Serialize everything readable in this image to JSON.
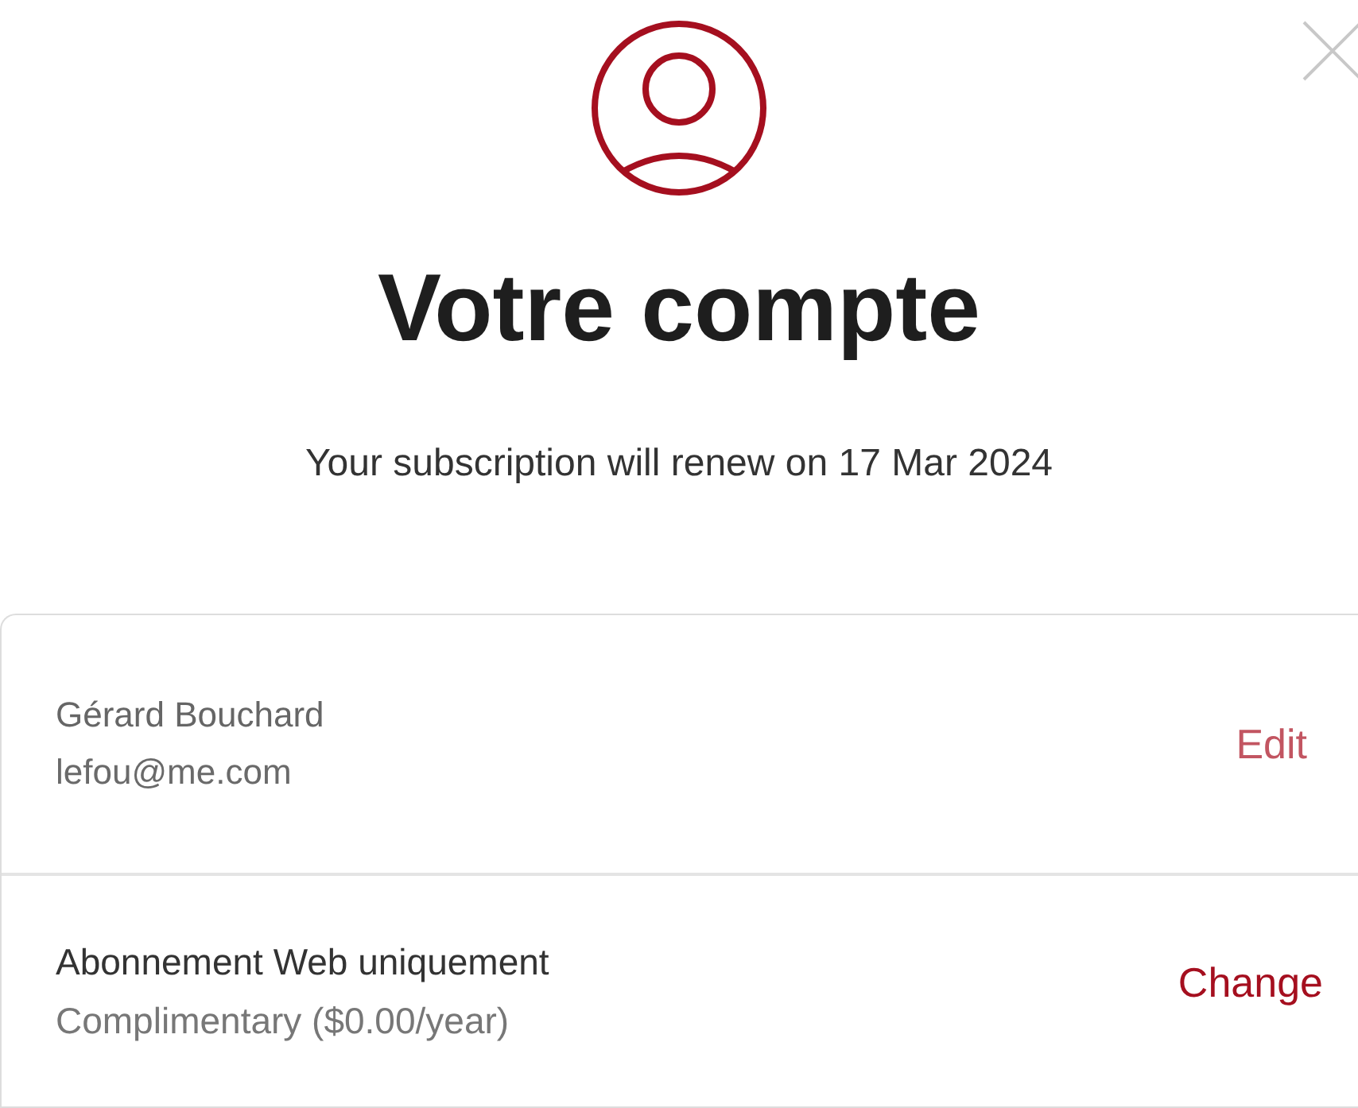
{
  "title": "Votre compte",
  "subtitle": "Your subscription will renew on 17 Mar 2024",
  "account": {
    "name": "Gérard Bouchard",
    "email": "lefou@me.com",
    "action": "Edit"
  },
  "subscription": {
    "plan": "Abonnement Web uniquement",
    "price": "Complimentary ($0.00/year)",
    "action": "Change"
  }
}
